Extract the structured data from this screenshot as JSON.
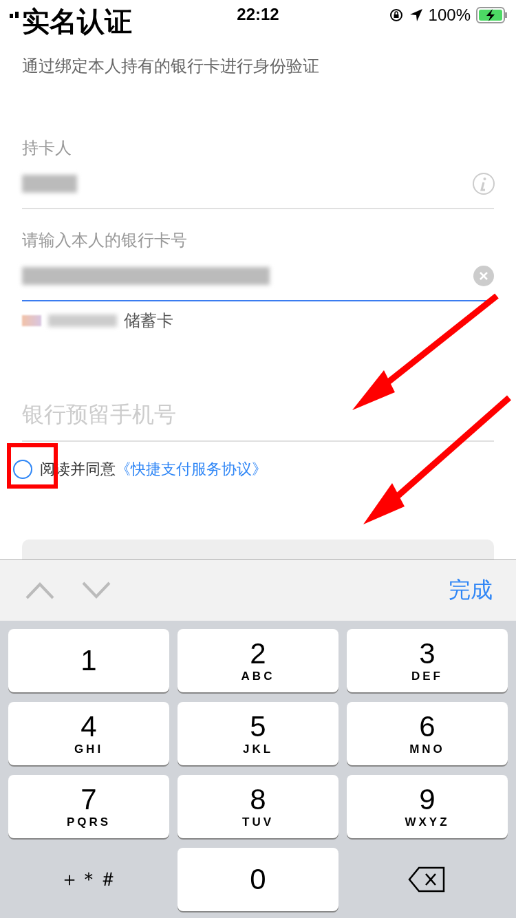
{
  "status_bar": {
    "time": "22:12",
    "battery": "100%"
  },
  "title": "实名认证",
  "subtitle": "通过绑定本人持有的银行卡进行身份验证",
  "cardholder": {
    "label": "持卡人"
  },
  "card_number": {
    "label": "请输入本人的银行卡号",
    "card_type": "储蓄卡"
  },
  "phone": {
    "placeholder": "银行预留手机号"
  },
  "agreement": {
    "checked": false,
    "text": "阅读并同意",
    "link": "《快捷支付服务协议》"
  },
  "keyboard": {
    "done": "完成",
    "keys": [
      {
        "kind": "digit",
        "digit": "1"
      },
      {
        "kind": "digit",
        "digit": "2",
        "letters": "ABC"
      },
      {
        "kind": "digit",
        "digit": "3",
        "letters": "DEF"
      },
      {
        "kind": "digit",
        "digit": "4",
        "letters": "GHI"
      },
      {
        "kind": "digit",
        "digit": "5",
        "letters": "JKL"
      },
      {
        "kind": "digit",
        "digit": "6",
        "letters": "MNO"
      },
      {
        "kind": "digit",
        "digit": "7",
        "letters": "PQRS"
      },
      {
        "kind": "digit",
        "digit": "8",
        "letters": "TUV"
      },
      {
        "kind": "digit",
        "digit": "9",
        "letters": "WXYZ"
      },
      {
        "kind": "symbols",
        "digit": "＋＊＃"
      },
      {
        "kind": "digit",
        "digit": "0"
      },
      {
        "kind": "delete"
      }
    ]
  }
}
